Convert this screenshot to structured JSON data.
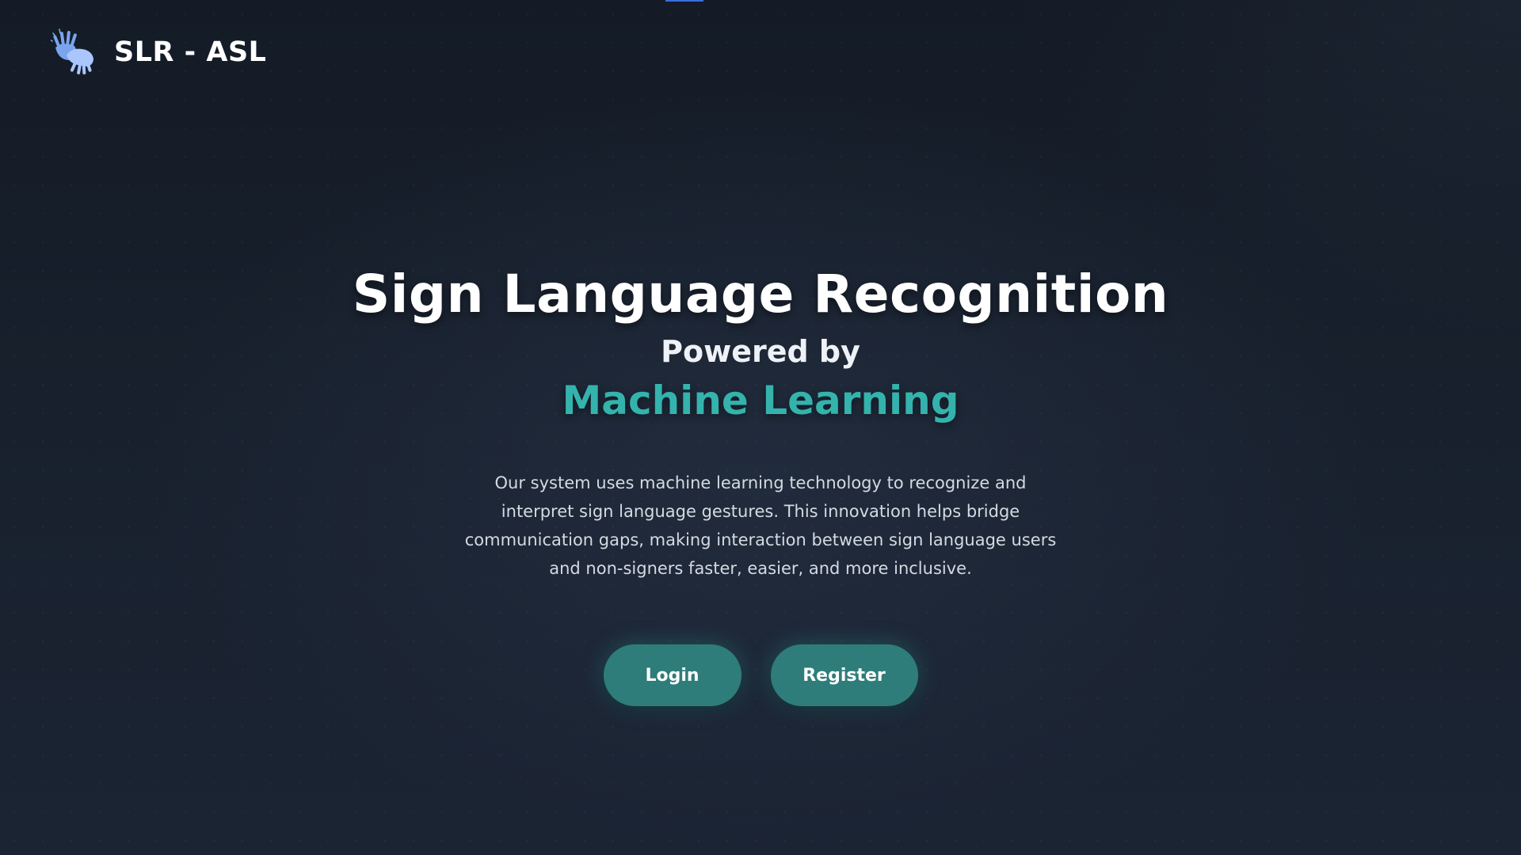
{
  "brand": {
    "title": "SLR - ASL",
    "icon": "sign-language-hands-icon",
    "icon_color": "#8fb4f5"
  },
  "hero": {
    "title": "Sign Language Recognition",
    "subtitle": "Powered by",
    "accent": "Machine Learning",
    "description": "Our system uses machine learning technology to recognize and interpret sign language gestures. This innovation helps bridge communication gaps, making interaction between sign language users and non-signers faster, easier, and more inclusive."
  },
  "actions": {
    "login_label": "Login",
    "register_label": "Register"
  },
  "colors": {
    "background": "#161d29",
    "accent_text": "#34b3ad",
    "button": "#2e7d7a",
    "top_indicator": "#3b6fd8"
  }
}
